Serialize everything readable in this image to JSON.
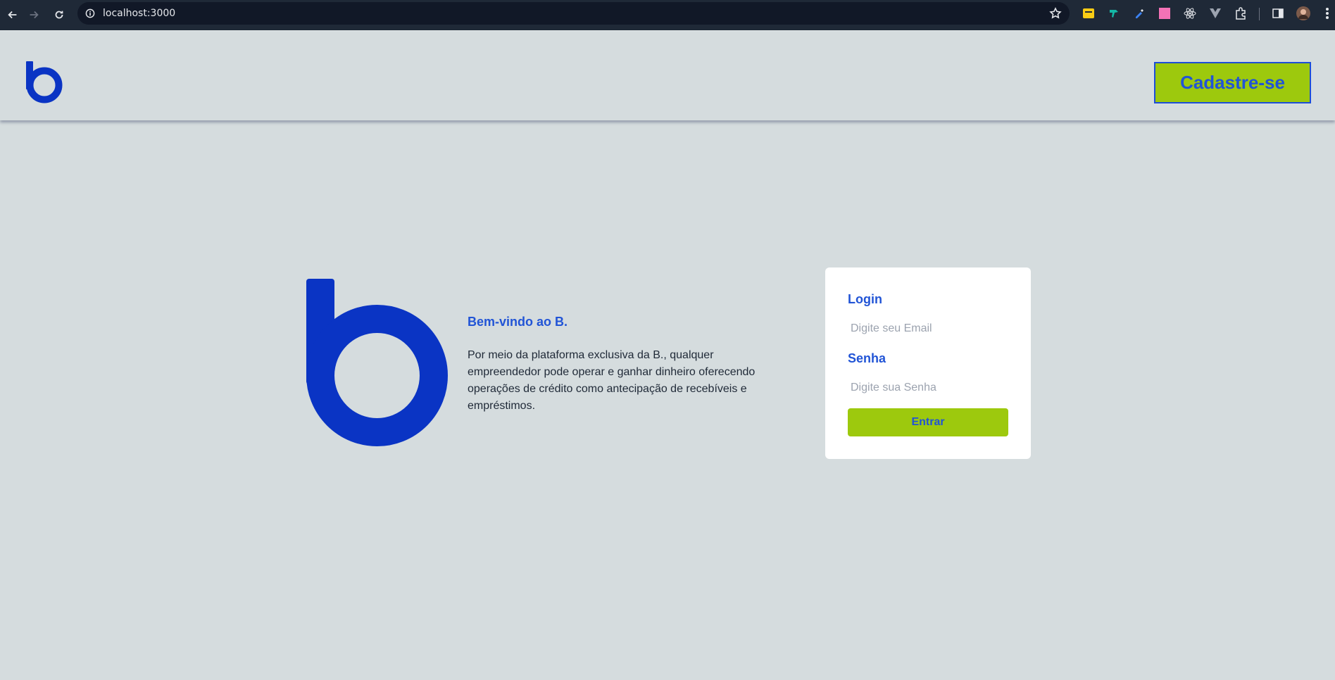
{
  "browser": {
    "url": "localhost:3000",
    "icons": [
      "back-arrow-icon",
      "forward-arrow-icon",
      "reload-icon",
      "site-info-icon",
      "bookmark-star-icon",
      "side-panel-icon",
      "profile-avatar-icon",
      "menu-dots-icon"
    ],
    "extensions": [
      "extension-yellow-icon",
      "extension-teal-icon",
      "extension-picker-icon",
      "extension-pink-icon",
      "react-devtools-icon",
      "vue-devtools-icon",
      "extensions-puzzle-icon"
    ]
  },
  "header": {
    "logo": "b-logo-icon",
    "signup_label": "Cadastre-se"
  },
  "hero": {
    "title": "Bem-vindo ao B.",
    "description": "Por meio da plataforma exclusiva da B., qualquer empreendedor pode operar e ganhar dinheiro oferecendo operações de crédito como antecipação de recebíveis e empréstimos."
  },
  "login": {
    "login_label": "Login",
    "email_placeholder": "Digite seu Email",
    "password_label": "Senha",
    "password_placeholder": "Digite sua Senha",
    "submit_label": "Entrar"
  },
  "colors": {
    "brand_blue": "#0a34c4",
    "accent_blue": "#2154d6",
    "lime": "#9dc90d",
    "background": "#d5dcde"
  }
}
